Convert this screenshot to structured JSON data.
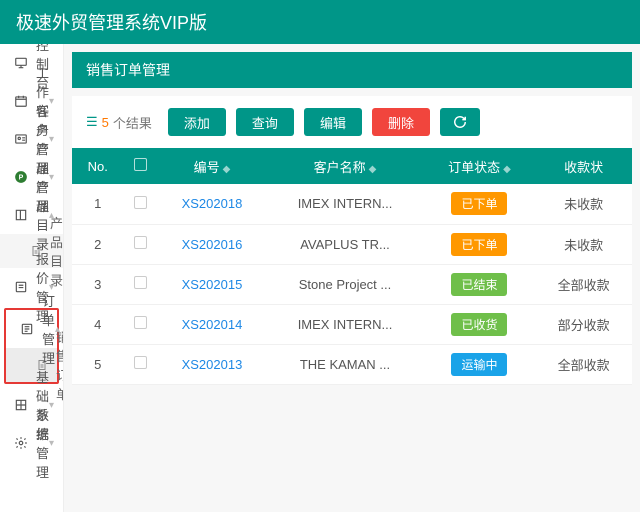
{
  "app_title": "极速外贸管理系统VIP版",
  "sidebar": {
    "items": [
      {
        "icon": "monitor",
        "label": "控制台",
        "expandable": false
      },
      {
        "icon": "calendar",
        "label": "工作任务",
        "expandable": true
      },
      {
        "icon": "id-card",
        "label": "客户管理",
        "expandable": true
      },
      {
        "icon": "p-circle",
        "label": "产品管理",
        "expandable": true
      },
      {
        "icon": "book",
        "label": "产品目录",
        "expandable": true,
        "open": true,
        "children": [
          {
            "label": "产品目录",
            "active": false
          }
        ]
      },
      {
        "icon": "quote",
        "label": "报价管理",
        "expandable": true
      },
      {
        "icon": "order",
        "label": "订单管理",
        "expandable": true,
        "open": true,
        "highlighted": true,
        "children": [
          {
            "label": "销售订单",
            "active": true
          }
        ]
      },
      {
        "icon": "grid",
        "label": "基础数据",
        "expandable": true
      },
      {
        "icon": "gear",
        "label": "系统管理",
        "expandable": true
      }
    ]
  },
  "page_header": "销售订单管理",
  "toolbar": {
    "result_prefix": "",
    "result_count": "5",
    "result_suffix": " 个结果",
    "add": "添加",
    "query": "查询",
    "edit": "编辑",
    "del": "删除"
  },
  "table": {
    "headers": {
      "no": "No.",
      "code": "编号",
      "customer": "客户名称",
      "status": "订单状态",
      "pay": "收款状"
    },
    "rows": [
      {
        "no": "1",
        "code": "XS202018",
        "customer": "IMEX INTERN...",
        "status": "已下单",
        "status_color": "#ff9800",
        "pay": "未收款"
      },
      {
        "no": "2",
        "code": "XS202016",
        "customer": "AVAPLUS TR...",
        "status": "已下单",
        "status_color": "#ff9800",
        "pay": "未收款"
      },
      {
        "no": "3",
        "code": "XS202015",
        "customer": "Stone Project ...",
        "status": "已结束",
        "status_color": "#6fbf4a",
        "pay": "全部收款"
      },
      {
        "no": "4",
        "code": "XS202014",
        "customer": "IMEX INTERN...",
        "status": "已收货",
        "status_color": "#6fbf4a",
        "pay": "部分收款"
      },
      {
        "no": "5",
        "code": "XS202013",
        "customer": "THE KAMAN ...",
        "status": "运输中",
        "status_color": "#1aa3e8",
        "pay": "全部收款"
      }
    ]
  }
}
